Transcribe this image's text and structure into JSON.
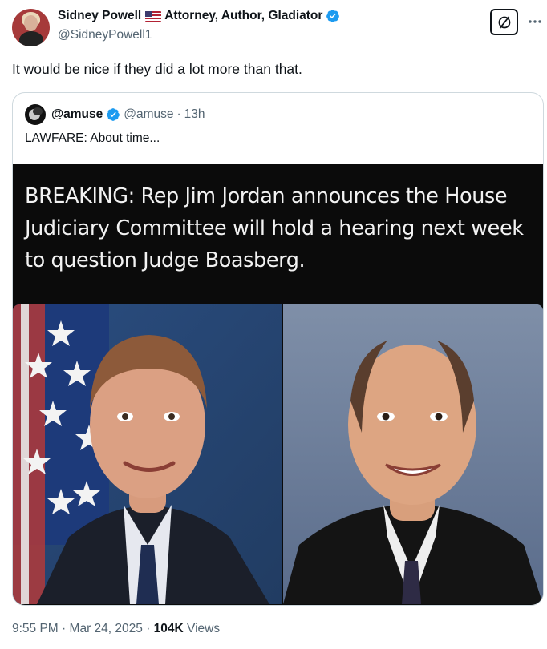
{
  "author": {
    "name": "Sidney Powell",
    "bio": "Attorney, Author, Gladiator",
    "handle": "@SidneyPowell1"
  },
  "tweet": {
    "text": "It would be nice if they did a lot more than that."
  },
  "quote": {
    "name": "@amuse",
    "handle": "@amuse",
    "separator": "·",
    "time": "13h",
    "text": "LAWFARE: About time...",
    "media": {
      "headline": "BREAKING: Rep Jim Jordan announces the House Judiciary Committee will hold a hearing next week to question Judge Boasberg."
    }
  },
  "footer": {
    "time": "9:55 PM",
    "sep1": "·",
    "date": "Mar 24, 2025",
    "sep2": "·",
    "views_count": "104K",
    "views_label": "Views"
  },
  "icons": {
    "flag": "us-flag-icon",
    "verified": "verified-badge-icon",
    "grok": "grok-icon",
    "more": "more-icon"
  },
  "colors": {
    "verified_blue": "#1d9bf0",
    "secondary_text": "#536471",
    "primary_text": "#0f1419",
    "border": "#cfd9de"
  }
}
